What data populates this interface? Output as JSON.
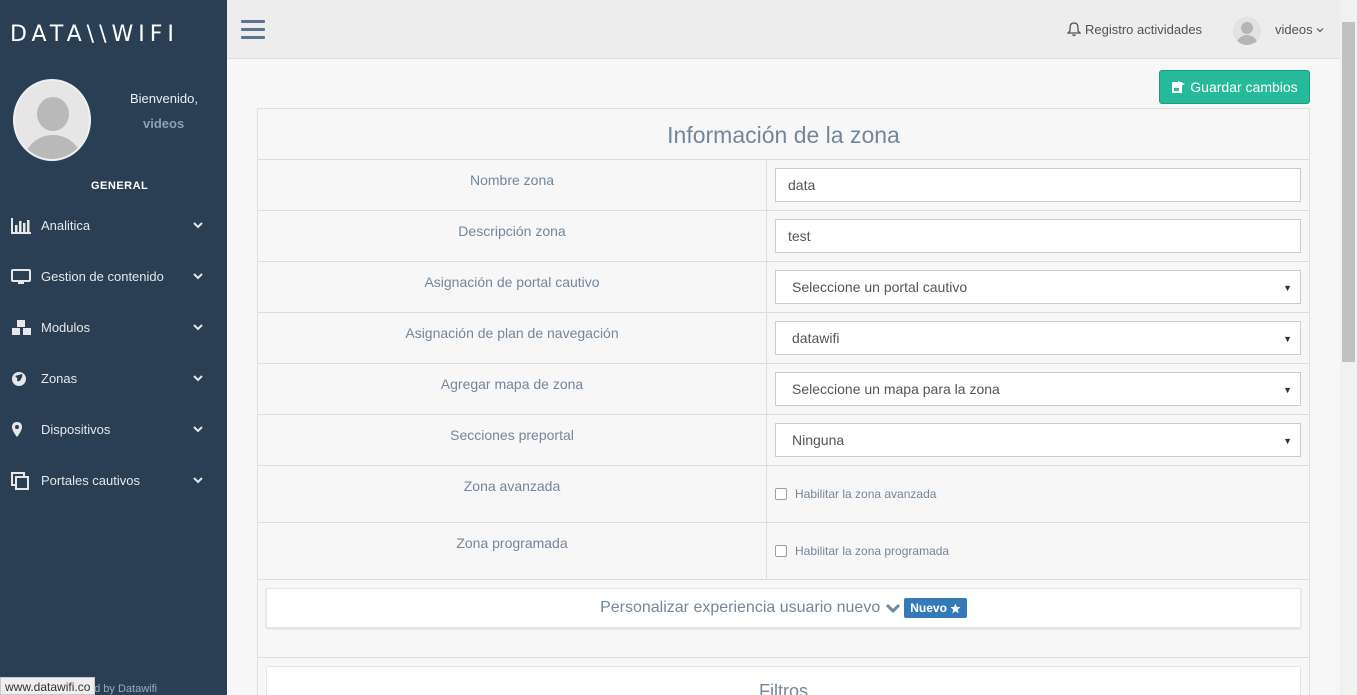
{
  "brand": "DATA\\\\WIFI",
  "sidebar": {
    "welcome": "Bienvenido,",
    "username": "videos",
    "section": "GENERAL",
    "items": [
      {
        "label": "Analitica",
        "icon": "bar-chart-icon"
      },
      {
        "label": "Gestion de contenido",
        "icon": "monitor-icon"
      },
      {
        "label": "Modulos",
        "icon": "cubes-icon"
      },
      {
        "label": "Zonas",
        "icon": "globe-icon"
      },
      {
        "label": "Dispositivos",
        "icon": "map-marker-icon"
      },
      {
        "label": "Portales cautivos",
        "icon": "clone-icon"
      }
    ],
    "footer_credit": "ed by Datawifi",
    "status_url": "www.datawifi.co"
  },
  "topbar": {
    "activity": "Registro actividades",
    "user": "videos"
  },
  "actions": {
    "save": "Guardar cambios"
  },
  "panel": {
    "title": "Información de la zona",
    "rows": [
      {
        "label": "Nombre zona",
        "value": "data"
      },
      {
        "label": "Descripción zona",
        "value": "test"
      },
      {
        "label": "Asignación de portal cautivo",
        "value": "Seleccione un portal cautivo"
      },
      {
        "label": "Asignación de plan de navegación",
        "value": "datawifi"
      },
      {
        "label": "Agregar mapa de zona",
        "value": "Seleccione un mapa para la zona"
      },
      {
        "label": "Secciones preportal",
        "value": "Ninguna"
      },
      {
        "label": "Zona avanzada",
        "checkbox": "Habilitar la zona avanzada"
      },
      {
        "label": "Zona programada",
        "checkbox": "Habilitar la zona programada"
      }
    ],
    "customize": "Personalizar experiencia usuario nuevo",
    "badge": "Nuevo",
    "filters": "Filtros"
  },
  "colors": {
    "sidebar": "#2a3f54",
    "accent_green": "#26b99a",
    "badge_blue": "#337ab7",
    "text_muted": "#73879c"
  }
}
